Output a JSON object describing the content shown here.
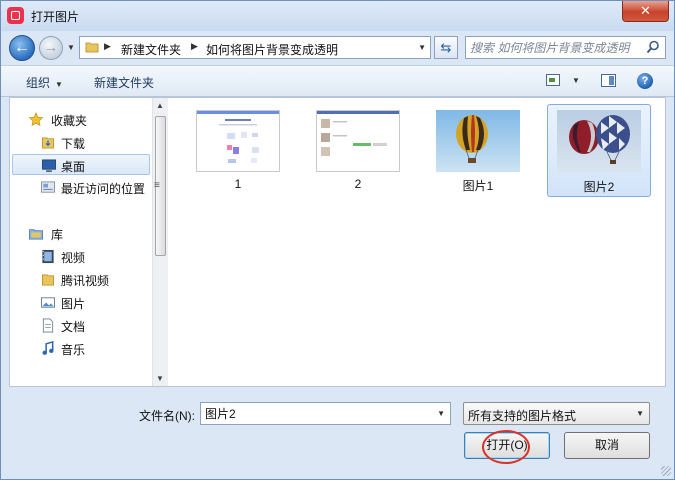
{
  "window": {
    "title": "打开图片",
    "close_label": "✕"
  },
  "address": {
    "crumbs": [
      "新建文件夹",
      "如何将图片背景变成透明"
    ],
    "search_placeholder": "搜索 如何将图片背景变成透明"
  },
  "toolbar": {
    "organize": "组织",
    "new_folder": "新建文件夹"
  },
  "nav": {
    "favorites": [
      {
        "label": "收藏夹",
        "icon": "star-icon"
      },
      {
        "label": "下载",
        "icon": "download-folder-icon"
      },
      {
        "label": "桌面",
        "icon": "desktop-icon"
      },
      {
        "label": "最近访问的位置",
        "icon": "recent-places-icon"
      }
    ],
    "libraries": [
      {
        "label": "库",
        "icon": "library-icon"
      },
      {
        "label": "视频",
        "icon": "video-icon"
      },
      {
        "label": "腾讯视频",
        "icon": "folder-icon"
      },
      {
        "label": "图片",
        "icon": "pictures-icon"
      },
      {
        "label": "文档",
        "icon": "documents-icon"
      },
      {
        "label": "音乐",
        "icon": "music-icon"
      }
    ]
  },
  "files": [
    {
      "label": "1"
    },
    {
      "label": "2"
    },
    {
      "label": "图片1"
    },
    {
      "label": "图片2"
    }
  ],
  "bottom": {
    "filename_label": "文件名(N):",
    "filename_value": "图片2",
    "filter_label": "所有支持的图片格式",
    "open_label": "打开(O)",
    "cancel_label": "取消"
  }
}
